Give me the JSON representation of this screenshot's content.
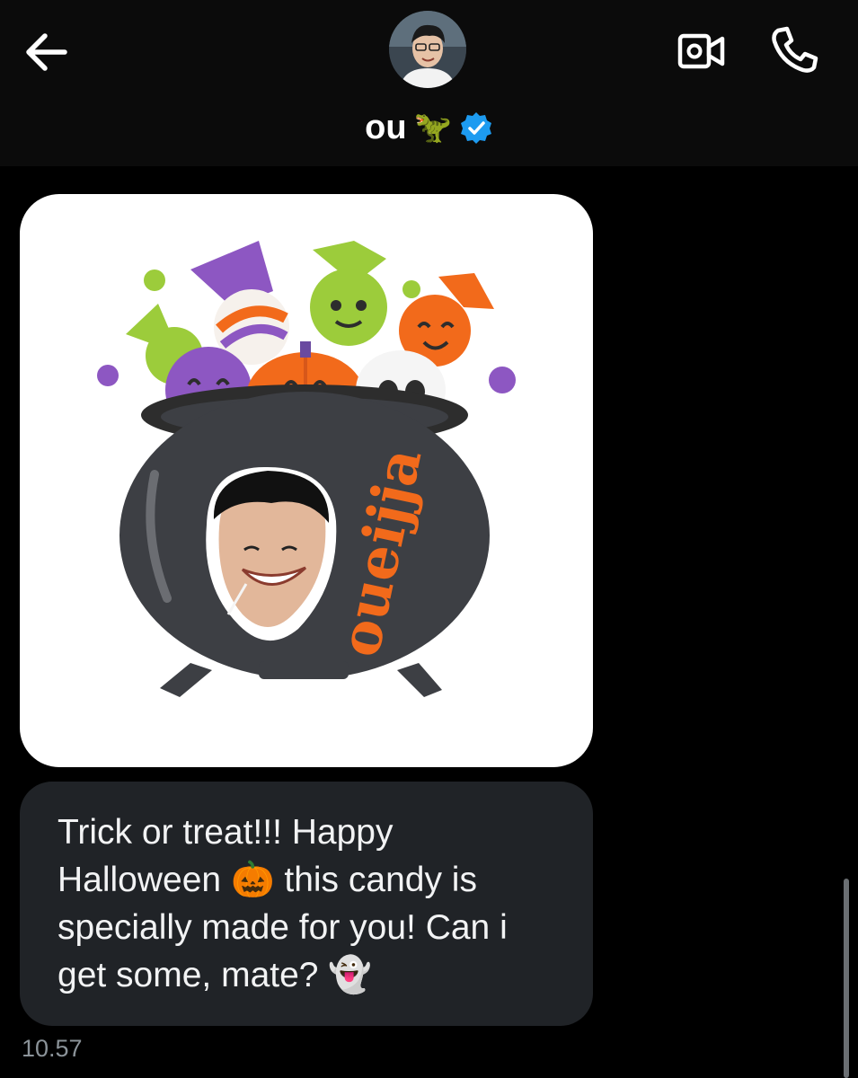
{
  "header": {
    "contact_name": "ou",
    "name_emoji": "🦖",
    "verified": true,
    "icons": [
      "back-arrow-icon",
      "avatar",
      "verified-badge-icon",
      "video-call-icon",
      "phone-call-icon"
    ]
  },
  "message": {
    "sticker": {
      "brand_text": "oueijja",
      "description_icons": [
        "cauldron",
        "candies",
        "pumpkin",
        "skull",
        "face-cutout"
      ]
    },
    "line1": "Trick or treat!!! Happy",
    "line2a": "Halloween",
    "line2_emoji": "🎃",
    "line2b": "this candy is",
    "line3": "specially made for you! Can i",
    "line4": "get some, mate?",
    "line4_emoji": "👻",
    "time": "10.57"
  },
  "colors": {
    "background": "#000000",
    "header": "#0b0b0b",
    "bubble": "#202327",
    "verified": "#1d9bf0",
    "sticker_orange": "#f26a1b"
  }
}
